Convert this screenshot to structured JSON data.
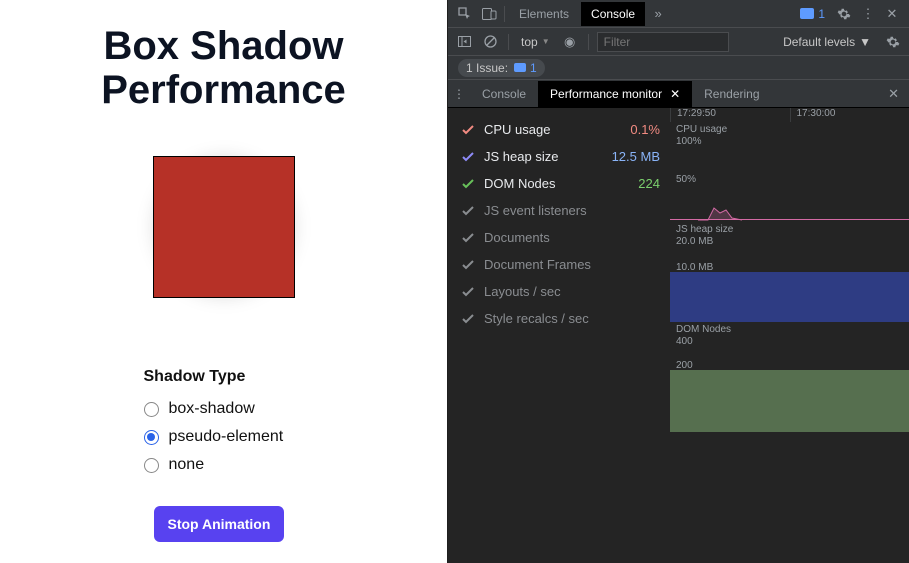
{
  "page": {
    "title_line1": "Box Shadow",
    "title_line2": "Performance",
    "controls_heading": "Shadow Type",
    "options": [
      {
        "label": "box-shadow",
        "checked": false
      },
      {
        "label": "pseudo-element",
        "checked": true
      },
      {
        "label": "none",
        "checked": false
      }
    ],
    "button_label": "Stop Animation"
  },
  "devtools": {
    "tabs": {
      "elements": "Elements",
      "console": "Console"
    },
    "messages_count": "1",
    "context_label": "top",
    "filter_placeholder": "Filter",
    "levels_label": "Default levels",
    "issues": {
      "label": "1 Issue:",
      "count": "1"
    },
    "drawer": {
      "console": "Console",
      "perfmon": "Performance monitor",
      "rendering": "Rendering"
    },
    "metrics": [
      {
        "name": "CPU usage",
        "value": "0.1%",
        "color": "#f28b82",
        "checkColor": "#f28b82",
        "on": true
      },
      {
        "name": "JS heap size",
        "value": "12.5 MB",
        "color": "#8ab4f8",
        "checkColor": "#8e8bf8",
        "on": true
      },
      {
        "name": "DOM Nodes",
        "value": "224",
        "color": "#7bcf6d",
        "checkColor": "#68c15a",
        "on": true
      },
      {
        "name": "JS event listeners",
        "value": "",
        "color": "",
        "checkColor": "#8a8d91",
        "on": false
      },
      {
        "name": "Documents",
        "value": "",
        "color": "",
        "checkColor": "#8a8d91",
        "on": false
      },
      {
        "name": "Document Frames",
        "value": "",
        "color": "",
        "checkColor": "#8a8d91",
        "on": false
      },
      {
        "name": "Layouts / sec",
        "value": "",
        "color": "",
        "checkColor": "#8a8d91",
        "on": false
      },
      {
        "name": "Style recalcs / sec",
        "value": "",
        "color": "",
        "checkColor": "#8a8d91",
        "on": false
      }
    ],
    "timeline": {
      "t1": "17:29:50",
      "t2": "17:30:00"
    },
    "graphs": {
      "cpu": {
        "title": "CPU usage",
        "scale_top": "100%",
        "mid": "50%"
      },
      "heap": {
        "title": "JS heap size",
        "scale_top": "20.0 MB",
        "mid": "10.0 MB"
      },
      "dom": {
        "title": "DOM Nodes",
        "scale_top": "400",
        "mid": "200"
      }
    }
  }
}
